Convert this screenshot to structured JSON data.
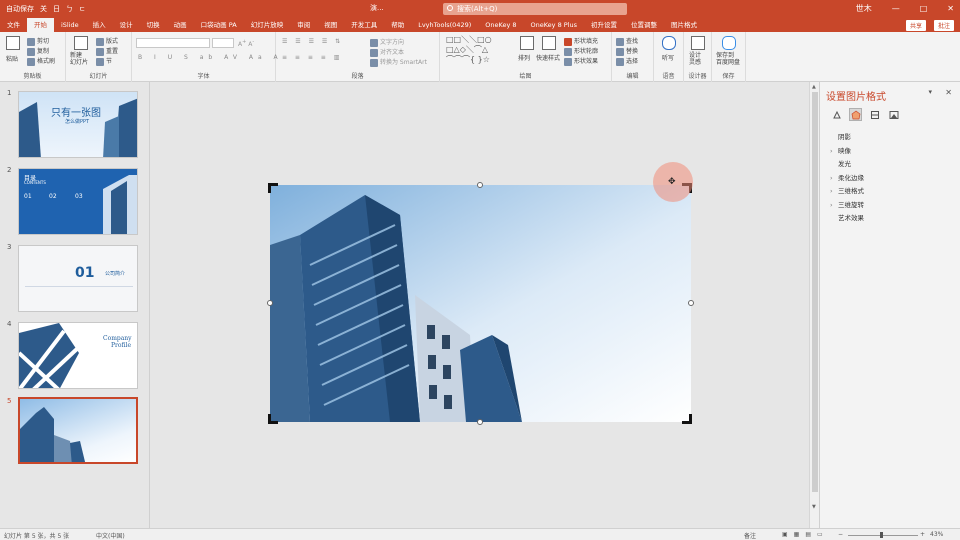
{
  "titlebar": {
    "qat_items": [
      "自动保存",
      "关",
      "日",
      "ㄅ",
      "ㄷ"
    ],
    "title": "演...",
    "search_placeholder": "搜索(Alt+Q)",
    "user": "世木",
    "window_controls": [
      "—",
      "□",
      "✕"
    ]
  },
  "tabs": [
    "文件",
    "开始",
    "iSlide",
    "插入",
    "设计",
    "切换",
    "动画",
    "口袋动画 PA",
    "幻灯片放映",
    "审阅",
    "视图",
    "开发工具",
    "帮助",
    "LvyhTools(0429)",
    "OneKey 8",
    "OneKey 8 Plus",
    "初升设置",
    "位置调整",
    "图片格式"
  ],
  "active_tab": "开始",
  "tab_right": [
    "共享",
    "批注"
  ],
  "ribbon": {
    "groups": [
      "剪贴板",
      "幻灯片",
      "字体",
      "段落",
      "绘图",
      "编辑",
      "语音",
      "设计器",
      "保存"
    ],
    "clipboard": {
      "paste": "粘贴",
      "cut": "剪切",
      "copy": "复制",
      "format": "格式刷"
    },
    "slides": {
      "new": "新建\n幻灯片",
      "layout": "版式",
      "reset": "重置",
      "section": "节"
    },
    "paragraph": {
      "text_dir": "文字方向",
      "align_text": "对齐文本",
      "smartart": "转换为 SmartArt"
    },
    "drawing": {
      "arrange": "排列",
      "quick_styles": "快速样式",
      "fill": "形状填充",
      "outline": "形状轮廓",
      "effects": "形状效果"
    },
    "editing": {
      "find": "查找",
      "replace": "替换",
      "select": "选择"
    },
    "voice": {
      "dictate": "听写"
    },
    "designer": {
      "ideas": "设计\n灵感"
    },
    "save": {
      "save_to": "保存到\n百度网盘"
    }
  },
  "slides": [
    {
      "num": "1",
      "title": "只有一张图",
      "subtitle": "怎么做PPT"
    },
    {
      "num": "2",
      "title": "目录",
      "subtitle": "CONTENTS",
      "items": [
        "01",
        "02",
        "03"
      ]
    },
    {
      "num": "3",
      "title": "01",
      "subtitle": "公司简介"
    },
    {
      "num": "4",
      "title": "Company",
      "subtitle": "Profile"
    },
    {
      "num": "5",
      "title": "",
      "subtitle": ""
    }
  ],
  "selected_slide": "5",
  "format_pane": {
    "title": "设置图片格式",
    "items": [
      "阴影",
      "映像",
      "发光",
      "柔化边缘",
      "三维格式",
      "三维旋转",
      "艺术效果"
    ],
    "expandable": [
      false,
      true,
      false,
      true,
      true,
      true,
      false
    ]
  },
  "statusbar": {
    "slide_info": "幻灯片 第 5 张，共 5 张",
    "language": "中文(中国)",
    "notes": "备注",
    "zoom": "43%"
  },
  "colors": {
    "accent": "#c8472a",
    "sky_top": "#7fb0dc",
    "building": "#2d5a8a"
  }
}
